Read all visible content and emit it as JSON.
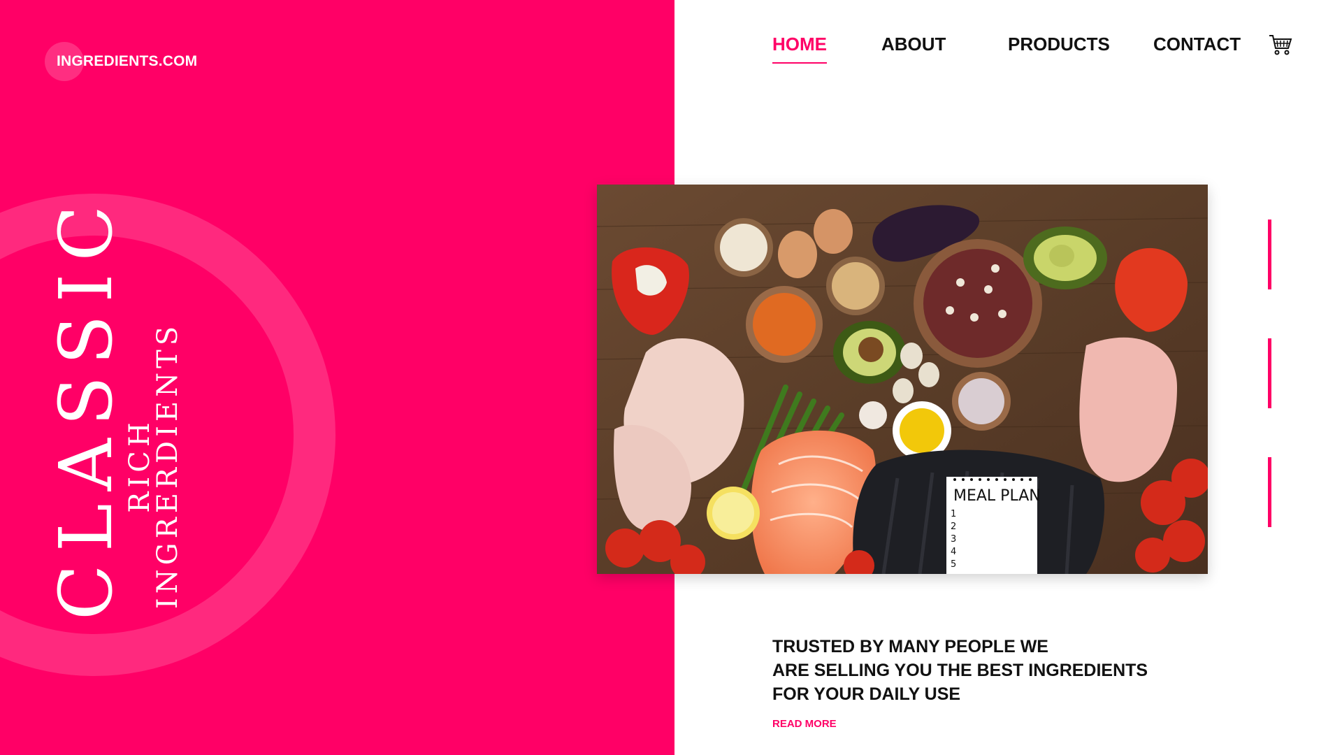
{
  "site": {
    "logo_text": "INGREDIENTS.COM"
  },
  "hero": {
    "title": "CLASSIC",
    "subtitle": "RICH INGRERDIENTS"
  },
  "nav": {
    "items": [
      {
        "label": "HOME",
        "active": true
      },
      {
        "label": "ABOUT",
        "active": false
      },
      {
        "label": "PRODUCTS",
        "active": false
      },
      {
        "label": "CONTACT",
        "active": false
      }
    ],
    "cart_icon": "cart-icon"
  },
  "image": {
    "meal_plan_label": "MEAL PLAN",
    "meal_plan_numbers": [
      "1",
      "2",
      "3",
      "4",
      "5"
    ]
  },
  "tagline": {
    "lines": [
      "TRUSTED BY MANY PEOPLE WE",
      "ARE SELLING YOU THE BEST INGREDIENTS",
      "FOR YOUR DAILY USE"
    ],
    "cta": "READ MORE"
  },
  "colors": {
    "accent": "#ff0066",
    "text": "#111111",
    "background": "#ffffff"
  }
}
